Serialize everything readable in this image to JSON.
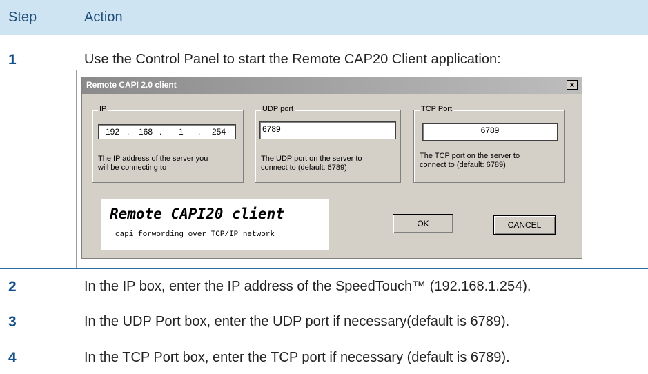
{
  "table": {
    "headers": {
      "step": "Step",
      "action": "Action"
    },
    "rows": [
      {
        "step": "1",
        "action": "Use the Control Panel to start the Remote CAP20 Client application:"
      },
      {
        "step": "2",
        "action": "In the IP box, enter the IP address of the SpeedTouch™ (192.168.1.254)."
      },
      {
        "step": "3",
        "action": "In the UDP Port box, enter the UDP port if necessary(default is 6789)."
      },
      {
        "step": "4",
        "action": "In the TCP Port box, enter the TCP port if necessary (default is 6789)."
      }
    ]
  },
  "dialog": {
    "title": "Remote CAPI 2.0  client",
    "close_glyph": "×",
    "ip": {
      "legend": "IP",
      "octets": [
        "192",
        "168",
        "1",
        "254"
      ],
      "dot": ".",
      "desc_line1": "The IP address of the server you",
      "desc_line2": "will be connecting to"
    },
    "udp": {
      "legend": "UDP port",
      "value": "6789",
      "desc_line1": "The UDP port on the server to",
      "desc_line2": "connect to (default: 6789)"
    },
    "tcp": {
      "legend": "TCP Port",
      "value": "6789",
      "desc_line1": "The TCP port on the server to",
      "desc_line2": "connect to (default: 6789)"
    },
    "logo": {
      "title": "Remote CAPI20 client",
      "subtitle": "capi forwording over TCP/IP network"
    },
    "ok_label": "OK",
    "cancel_label": "CANCEL"
  }
}
